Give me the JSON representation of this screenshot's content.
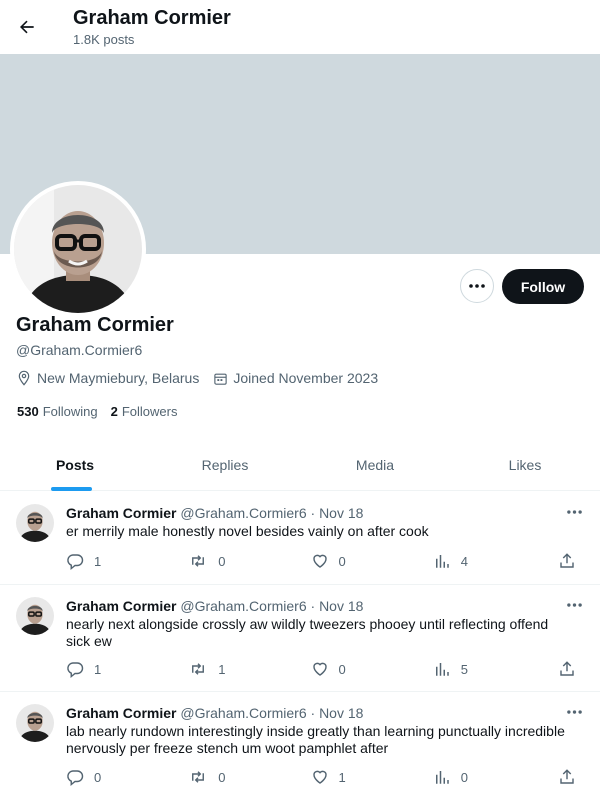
{
  "header": {
    "title": "Graham Cormier",
    "post_count": "1.8K posts"
  },
  "profile": {
    "name": "Graham Cormier",
    "handle": "@Graham.Cormier6",
    "location": "New Maymiebury, Belarus",
    "joined": "Joined November 2023",
    "following_count": "530",
    "following_label": "Following",
    "followers_count": "2",
    "followers_label": "Followers",
    "follow_label": "Follow"
  },
  "tabs": [
    {
      "label": "Posts",
      "active": true
    },
    {
      "label": "Replies",
      "active": false
    },
    {
      "label": "Media",
      "active": false
    },
    {
      "label": "Likes",
      "active": false
    }
  ],
  "posts": [
    {
      "name": "Graham Cormier",
      "handle": "@Graham.Cormier6",
      "date": "· Nov 18",
      "text": "er merrily male honestly novel besides vainly on after cook",
      "replies": "1",
      "reposts": "0",
      "likes": "0",
      "views": "4"
    },
    {
      "name": "Graham Cormier",
      "handle": "@Graham.Cormier6",
      "date": "· Nov 18",
      "text": "nearly next alongside crossly aw wildly tweezers phooey until reflecting offend sick ew",
      "replies": "1",
      "reposts": "1",
      "likes": "0",
      "views": "5"
    },
    {
      "name": "Graham Cormier",
      "handle": "@Graham.Cormier6",
      "date": "· Nov 18",
      "text": "lab nearly rundown interestingly inside greatly than learning punctually incredible nervously per freeze stench um woot pamphlet after",
      "replies": "0",
      "reposts": "0",
      "likes": "1",
      "views": "0"
    }
  ],
  "colors": {
    "banner": "#cfd9de",
    "accent": "#1d9bf0",
    "follow_button": "#0f1419"
  },
  "icons": [
    "back-arrow-icon",
    "more-icon",
    "location-icon",
    "calendar-icon",
    "reply-icon",
    "repost-icon",
    "like-icon",
    "views-icon",
    "share-icon"
  ]
}
